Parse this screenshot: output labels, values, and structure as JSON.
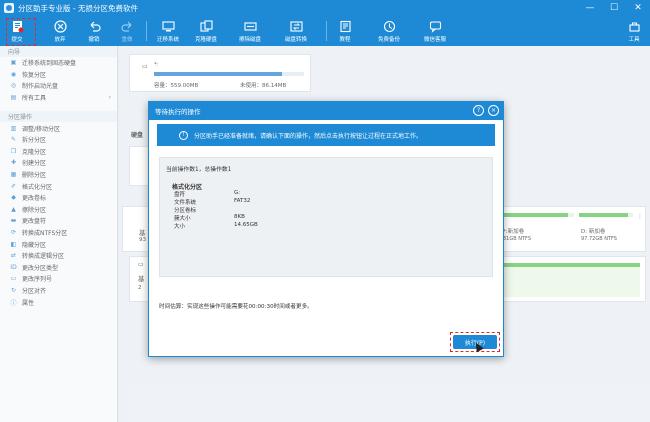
{
  "window": {
    "title": "分区助手专业版 - 无损分区免费软件"
  },
  "toolbar": {
    "items": [
      {
        "label": "提交",
        "icon": "submit-icon"
      },
      {
        "label": "放弃",
        "icon": "discard-icon"
      },
      {
        "label": "撤销",
        "icon": "undo-icon"
      },
      {
        "label": "重做",
        "icon": "redo-icon"
      },
      {
        "label": "迁移系统",
        "icon": "migrate-os-icon"
      },
      {
        "label": "克隆硬盘",
        "icon": "clone-disk-icon"
      },
      {
        "label": "擦除磁盘",
        "icon": "wipe-disk-icon"
      },
      {
        "label": "磁盘转换",
        "icon": "disk-convert-icon"
      },
      {
        "label": "教程",
        "icon": "tutorial-icon"
      },
      {
        "label": "免费备份",
        "icon": "free-backup-icon"
      },
      {
        "label": "微信客服",
        "icon": "wechat-support-icon"
      },
      {
        "label": "工具",
        "icon": "tools-icon"
      }
    ]
  },
  "sidebar": {
    "wizard_header": "向导",
    "wizard_items": [
      {
        "label": "迁移系统到固态硬盘",
        "icon": "migrate-icon"
      },
      {
        "label": "恢复分区",
        "icon": "recover-icon"
      },
      {
        "label": "制作启动光盘",
        "icon": "boot-disc-icon"
      },
      {
        "label": "所有工具",
        "icon": "all-tools-icon",
        "arrow": "›"
      }
    ],
    "ops_header": "分区操作",
    "ops_items": [
      {
        "label": "调整/移动分区",
        "icon": "resize-icon"
      },
      {
        "label": "拆分分区",
        "icon": "split-icon"
      },
      {
        "label": "克隆分区",
        "icon": "clone-icon"
      },
      {
        "label": "创建分区",
        "icon": "create-icon"
      },
      {
        "label": "删除分区",
        "icon": "delete-icon"
      },
      {
        "label": "格式化分区",
        "icon": "format-icon"
      },
      {
        "label": "更改卷标",
        "icon": "label-icon"
      },
      {
        "label": "擦除分区",
        "icon": "wipe-icon"
      },
      {
        "label": "更改盘符",
        "icon": "drive-letter-icon"
      },
      {
        "label": "转换成NTFS分区",
        "icon": "ntfs-icon"
      },
      {
        "label": "隐藏分区",
        "icon": "hide-icon"
      },
      {
        "label": "转换成逻辑分区",
        "icon": "logical-icon"
      },
      {
        "label": "更改分区类型",
        "icon": "type-icon"
      },
      {
        "label": "更改序列号",
        "icon": "serial-icon"
      },
      {
        "label": "分区对齐",
        "icon": "align-icon"
      },
      {
        "label": "属性",
        "icon": "properties-icon"
      }
    ]
  },
  "main": {
    "top_disk": {
      "name": "*:",
      "capacity": "容量：559.00MB",
      "free": "未使用：86.14MB",
      "fill": 0.85
    },
    "disk_label_fragment": "硬盘",
    "right_vols": [
      {
        "name": "*:新加卷",
        "detail": "31GB NTFS",
        "fill": 0.92
      },
      {
        "name": "D: 新加卷",
        "detail": "97.72GB NTFS",
        "fill": 0.9
      }
    ],
    "left_frag1": "基",
    "left_frag2": "93",
    "left_frag3": "基",
    "left_frag4": "2"
  },
  "dialog": {
    "title": "等待执行的操作",
    "info_text": "分区助手已经准备就绪，请确认下面的操作，然后点击执行按钮让过程在正式地工作。",
    "op_count": "当前操作数1，总操作数1",
    "op_title": "格式化分区",
    "rows": [
      {
        "k": "盘符",
        "v": "G:"
      },
      {
        "k": "文件系统",
        "v": "FAT32"
      },
      {
        "k": "分区卷标",
        "v": ""
      },
      {
        "k": "簇大小",
        "v": "8KB"
      },
      {
        "k": "大小",
        "v": "14.65GB"
      }
    ],
    "estimate": "时间估算：实现这些操作可能需要花00:00:30时间或者更多。",
    "execute_label": "执行(P)"
  },
  "colors": {
    "accent": "#1e8ad6",
    "highlight": "#e3262c"
  }
}
